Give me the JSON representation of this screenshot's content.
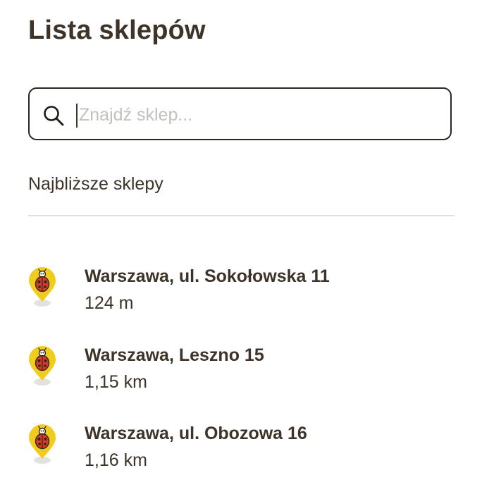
{
  "page": {
    "title": "Lista sklepów"
  },
  "search": {
    "placeholder": "Znajdź sklep...",
    "value": ""
  },
  "section": {
    "nearest_label": "Najbliższe sklepy"
  },
  "stores": [
    {
      "name": "Warszawa, ul. Sokołowska 11",
      "distance": "124 m"
    },
    {
      "name": "Warszawa, Leszno 15",
      "distance": "1,15 km"
    },
    {
      "name": "Warszawa, ul. Obozowa 16",
      "distance": "1,16 km"
    }
  ],
  "icons": {
    "search": "search-icon",
    "store_pin": "ladybug-map-pin-icon"
  },
  "colors": {
    "text": "#3d3328",
    "pin_yellow": "#f2cc1d",
    "ladybug_red": "#d63b2a",
    "divider": "#e2e0dd"
  }
}
